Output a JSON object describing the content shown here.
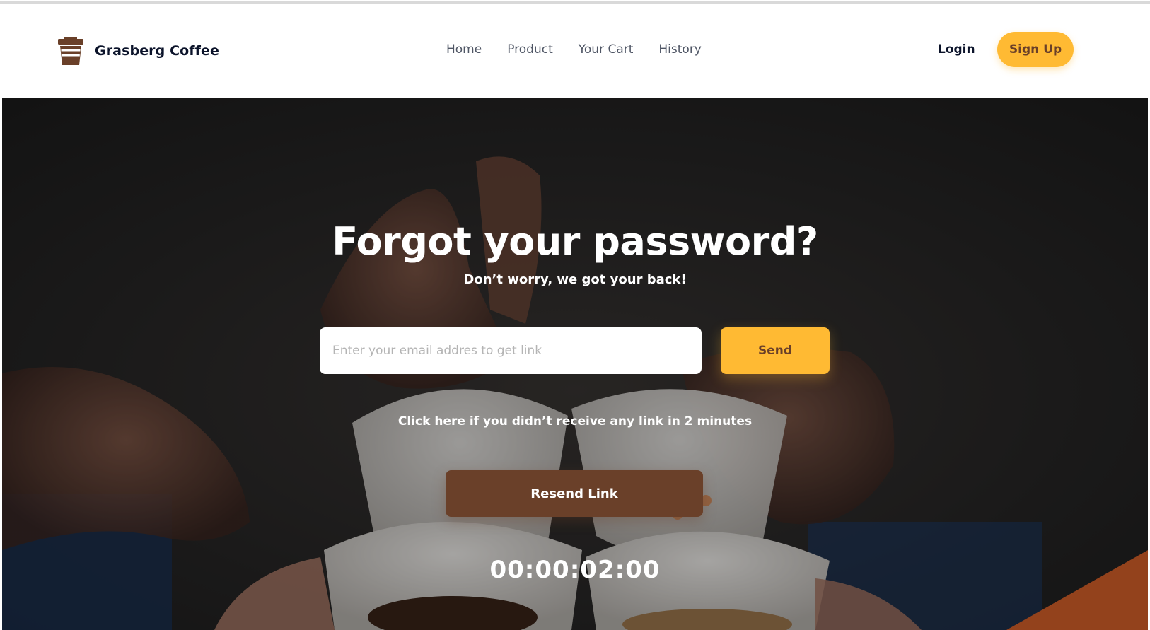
{
  "header": {
    "brand_name": "Grasberg Coffee",
    "logo_icon": "coffee-cup-icon",
    "nav": [
      {
        "label": "Home"
      },
      {
        "label": "Product"
      },
      {
        "label": "Your Cart"
      },
      {
        "label": "History"
      }
    ],
    "login_label": "Login",
    "signup_label": "Sign Up"
  },
  "hero": {
    "title": "Forgot your password?",
    "subtitle": "Don’t worry, we got your back!",
    "email_placeholder": "Enter your email addres to get link",
    "email_value": "",
    "send_label": "Send",
    "help_text": "Click here if you didn’t receive any link in 2 minutes",
    "resend_label": "Resend Link",
    "timer": "00:00:02:00"
  },
  "colors": {
    "accent": "#ffba33",
    "brand_brown": "#6a4029",
    "nav_text": "#4f5665",
    "heading_dark": "#0b132a"
  }
}
